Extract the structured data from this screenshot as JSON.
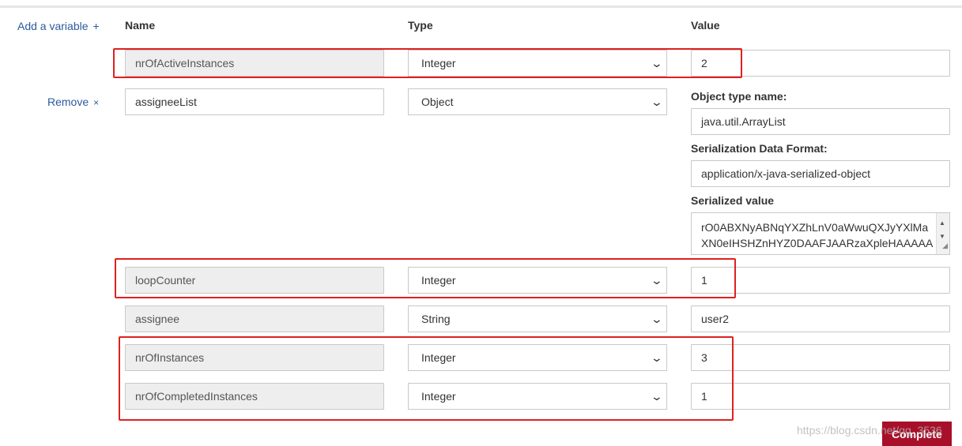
{
  "actions": {
    "add_variable": "Add a variable",
    "add_symbol": "+",
    "remove": "Remove",
    "remove_symbol": "×",
    "complete": "Complete"
  },
  "headers": {
    "name": "Name",
    "type": "Type",
    "value": "Value"
  },
  "rows": [
    {
      "name": "nrOfActiveInstances",
      "type": "Integer",
      "value": "2"
    },
    {
      "name": "assigneeList",
      "type": "Object",
      "object_type_label": "Object type name:",
      "object_type_value": "java.util.ArrayList",
      "serialization_label": "Serialization Data Format:",
      "serialization_value": "application/x-java-serialized-object",
      "serialized_label": "Serialized value",
      "serialized_value": "rO0ABXNyABNqYXZhLnV0aWwuQXJyYXlMaXN0eIHSHZnHYZ0DAAFJAARzaXpleHAAAAA"
    },
    {
      "name": "loopCounter",
      "type": "Integer",
      "value": "1"
    },
    {
      "name": "assignee",
      "type": "String",
      "value": "user2"
    },
    {
      "name": "nrOfInstances",
      "type": "Integer",
      "value": "3"
    },
    {
      "name": "nrOfCompletedInstances",
      "type": "Integer",
      "value": "1"
    }
  ],
  "icons": {
    "chevron": "chevron-down-icon",
    "scroll_up": "triangle-up-icon",
    "scroll_down": "triangle-down-icon",
    "resize": "resize-grip-icon"
  },
  "colors": {
    "link": "#2b5b9c",
    "highlight": "#e02020",
    "complete_button": "#a8102a",
    "readonly_bg": "#eeeeee"
  },
  "watermark": "https://blog.csdn.net/qq_3536"
}
